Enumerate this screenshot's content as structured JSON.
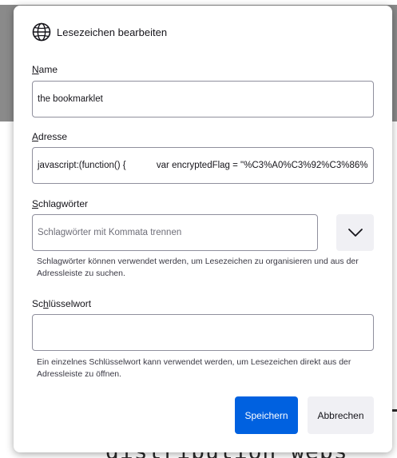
{
  "background": {
    "partial_text": "distribution webs"
  },
  "dialog": {
    "title": "Lesezeichen bearbeiten",
    "icon": "globe-icon"
  },
  "fields": {
    "name": {
      "label_accesskey": "N",
      "label_rest": "ame",
      "value": "the bookmarklet"
    },
    "address": {
      "label_accesskey": "A",
      "label_rest": "dresse",
      "value": "javascript:(function() {            var encryptedFlag = \"%C3%A0%C3%92%C3%86%"
    },
    "tags": {
      "label_accesskey": "S",
      "label_rest": "chlagwörter",
      "placeholder": "Schlagwörter mit Kommata trennen",
      "help": "Schlagwörter können verwendet werden, um Lesezeichen zu organisieren und aus der Adressleiste zu suchen.",
      "dropdown_icon": "chevron-down-icon"
    },
    "keyword": {
      "label_before": "Sc",
      "label_accesskey": "h",
      "label_after": "lüsselwort",
      "value": "",
      "help": "Ein einzelnes Schlüsselwort kann verwendet werden, um Lesezeichen direkt aus der Adressleiste zu öffnen."
    }
  },
  "buttons": {
    "save": "Speichern",
    "cancel": "Abbrechen"
  },
  "colors": {
    "primary": "#0061e0",
    "secondary": "#f0f0f4",
    "border": "#8f8f9d",
    "backdrop": "#8a8a8a"
  }
}
